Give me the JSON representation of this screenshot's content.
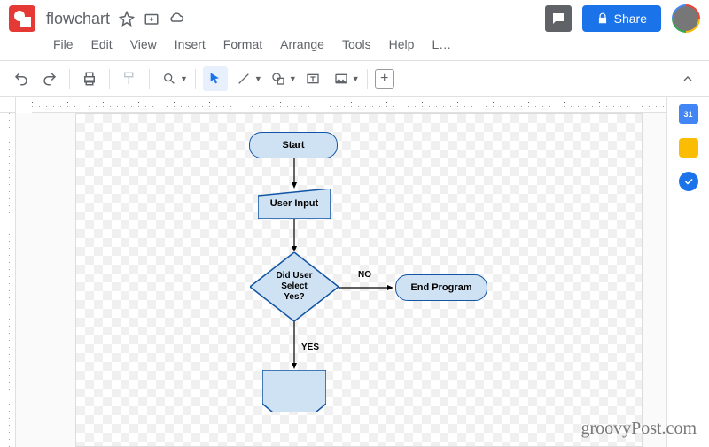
{
  "header": {
    "title": "flowchart",
    "share_label": "Share"
  },
  "menu": {
    "file": "File",
    "edit": "Edit",
    "view": "View",
    "insert": "Insert",
    "format": "Format",
    "arrange": "Arrange",
    "tools": "Tools",
    "help": "Help",
    "overflow": "L…"
  },
  "sidepanel": {
    "calendar_day": "31"
  },
  "flowchart": {
    "start": "Start",
    "user_input": "User Input",
    "decision": "Did User\nSelect\nYes?",
    "no_label": "NO",
    "yes_label": "YES",
    "end_program": "End Program"
  },
  "watermark": "groovyPost.com"
}
